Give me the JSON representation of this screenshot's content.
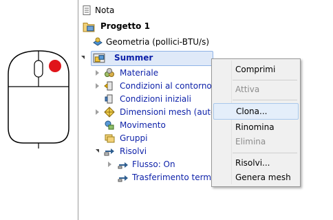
{
  "tree": {
    "nota": "Nota",
    "progetto": "Progetto 1",
    "geometria": "Geometria (pollici-BTU/s)",
    "summer": "Summer",
    "materiale": "Materiale",
    "condizioni_contorno": "Condizioni al contorno",
    "condizioni_iniziali": "Condizioni iniziali",
    "dimensioni_mesh": "Dimensioni mesh (autom",
    "movimento": "Movimento",
    "gruppi": "Gruppi",
    "risolvi": "Risolvi",
    "flusso": "Flusso: On",
    "trasferimento": "Trasferimento termi"
  },
  "context_menu": {
    "comprimi": "Comprimi",
    "attiva": "Attiva",
    "clona": "Clona...",
    "rinomina": "Rinomina",
    "elimina": "Elimina",
    "risolvi": "Risolvi...",
    "genera_mesh": "Genera mesh"
  },
  "colors": {
    "item_blue": "#0b1fa8",
    "mouse_button_dot": "#e0141a",
    "selection_bg": "#dfe9f8"
  }
}
